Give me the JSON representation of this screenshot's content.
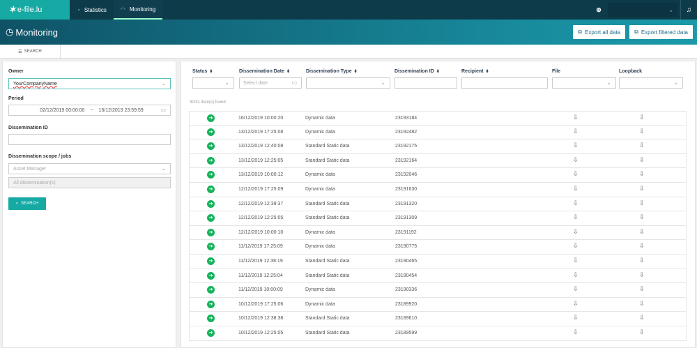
{
  "nav": {
    "logo": "e-file.lu",
    "tabs": [
      {
        "label": "Statistics"
      },
      {
        "label": "Monitoring"
      }
    ]
  },
  "header": {
    "title": "Monitoring",
    "export_all": "Export all data",
    "export_filtered": "Export filtered data"
  },
  "subtab": {
    "label": "SEARCH"
  },
  "filters": {
    "owner_label": "Owner",
    "owner_value": "YourCompanyName",
    "period_label": "Period",
    "period_from": "02/12/2019 00:00:00",
    "period_sep": "~",
    "period_to": "16/12/2019 23:59:59",
    "id_label": "Dissemination ID",
    "scope_label": "Dissemination scope / jobs",
    "scope_placeholder": "Asset Manager",
    "scope_all": "All dissemination(s)",
    "search_button": "SEARCH"
  },
  "table": {
    "headers": {
      "status": "Status",
      "date": "Dissemination Date",
      "type": "Dissemination Type",
      "id": "Dissemination ID",
      "recipient": "Recipient",
      "file": "File",
      "loopback": "Loopback"
    },
    "date_placeholder": "Select date",
    "found": "30/31 item(s) found",
    "rows": [
      {
        "date": "16/12/2019 10:00:20",
        "type": "Dynamic data",
        "id": "23193184"
      },
      {
        "date": "13/12/2019 17:25:08",
        "type": "Dynamic data",
        "id": "23192482"
      },
      {
        "date": "13/12/2019 12:40:08",
        "type": "Standard Static data",
        "id": "23192175"
      },
      {
        "date": "13/12/2019 12:25:05",
        "type": "Standard Static data",
        "id": "23192164"
      },
      {
        "date": "13/12/2019 10:00:12",
        "type": "Dynamic data",
        "id": "23192046"
      },
      {
        "date": "12/12/2019 17:25:09",
        "type": "Dynamic data",
        "id": "23191630"
      },
      {
        "date": "12/12/2019 12:39:37",
        "type": "Standard Static data",
        "id": "23191320"
      },
      {
        "date": "12/12/2019 12:25:05",
        "type": "Standard Static data",
        "id": "23191309"
      },
      {
        "date": "12/12/2019 10:00:10",
        "type": "Dynamic data",
        "id": "23191192"
      },
      {
        "date": "11/12/2019 17:25:09",
        "type": "Dynamic data",
        "id": "23190775"
      },
      {
        "date": "11/12/2019 12:38:19",
        "type": "Standard Static data",
        "id": "23190465"
      },
      {
        "date": "11/12/2019 12:25:04",
        "type": "Standard Static data",
        "id": "23190454"
      },
      {
        "date": "11/12/2019 10:00:09",
        "type": "Dynamic data",
        "id": "23190336"
      },
      {
        "date": "10/12/2019 17:25:06",
        "type": "Dynamic data",
        "id": "23189920"
      },
      {
        "date": "10/12/2019 12:38:38",
        "type": "Standard Static data",
        "id": "23189610"
      },
      {
        "date": "10/12/2019 12:25:05",
        "type": "Standard Static data",
        "id": "23189599"
      }
    ]
  },
  "colors": {
    "teal": "#17a9a4",
    "navy": "#0e3b4a",
    "status_ok": "#17b35c"
  }
}
